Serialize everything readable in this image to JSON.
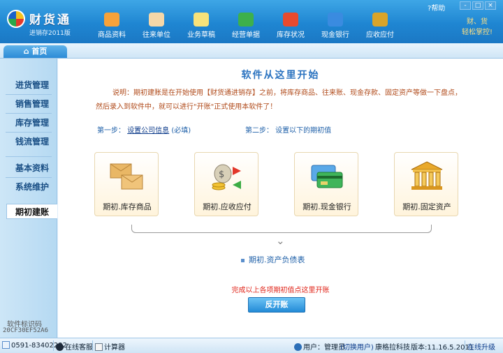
{
  "app": {
    "logo_name": "财货通",
    "logo_sub": "进销存2011版",
    "help": "帮助",
    "slogan_line1": "财、货",
    "slogan_line2": "轻松掌控!",
    "window_buttons": [
      "-",
      "□",
      "×"
    ]
  },
  "topnav": [
    {
      "label": "商品资料",
      "icon": "product-icon",
      "color": "#f6a23a"
    },
    {
      "label": "往来单位",
      "icon": "contact-person-icon",
      "color": "#f5d7a8"
    },
    {
      "label": "业务草稿",
      "icon": "draft-note-icon",
      "color": "#f7e27a"
    },
    {
      "label": "经营单据",
      "icon": "refresh-docs-icon",
      "color": "#3db04c"
    },
    {
      "label": "库存状况",
      "icon": "warehouse-house-icon",
      "color": "#e84a2e"
    },
    {
      "label": "现金银行",
      "icon": "bank-card-icon",
      "color": "#3a8be0"
    },
    {
      "label": "应收应付",
      "icon": "money-bag-icon",
      "color": "#d9a42a"
    }
  ],
  "breadcrumb": {
    "home": "首页"
  },
  "sidebar": {
    "items": [
      "进货管理",
      "销售管理",
      "库存管理",
      "钱流管理",
      "基本资料",
      "系统维护",
      "期初建账"
    ],
    "active": "期初建账",
    "id_label": "软件标识码",
    "id_value": "20CF30EF52A6"
  },
  "main": {
    "title": "软件从这里开始",
    "desc_line1": "说明：期初建账是在开始使用【财货通进销存】之前，将库存商品、往来账、现金存款、固定资产等做一下盘点，",
    "desc_line2": "然后录入到软件中，就可以进行\"开账\"正式使用本软件了！",
    "step1_prefix": "第一步：",
    "step1_link": "设置公司信息",
    "step1_suffix": "(必填)",
    "step2": "第二步：  设置以下的期初值",
    "cards": [
      {
        "label": "期初.库存商品",
        "icon": "cardboard-boxes-icon"
      },
      {
        "label": "期初.应收应付",
        "icon": "money-exchange-icon"
      },
      {
        "label": "期初.现金银行",
        "icon": "bank-cards-icon"
      },
      {
        "label": "期初.固定资产",
        "icon": "bank-building-icon"
      }
    ],
    "balance_sheet": "期初.资产负债表",
    "finish_text": "完成以上各项期初值点这里开账",
    "open_button": "反开账"
  },
  "status": {
    "phone": "0591-83402232",
    "online_service": "在线客服",
    "calculator": "计算器",
    "user_prefix": "用户：",
    "user": "管理员",
    "switch_user": "(切换用户)",
    "company": "康格拉科技",
    "version": "版本:11.16.5.2011",
    "upgrade": "在线升级"
  }
}
